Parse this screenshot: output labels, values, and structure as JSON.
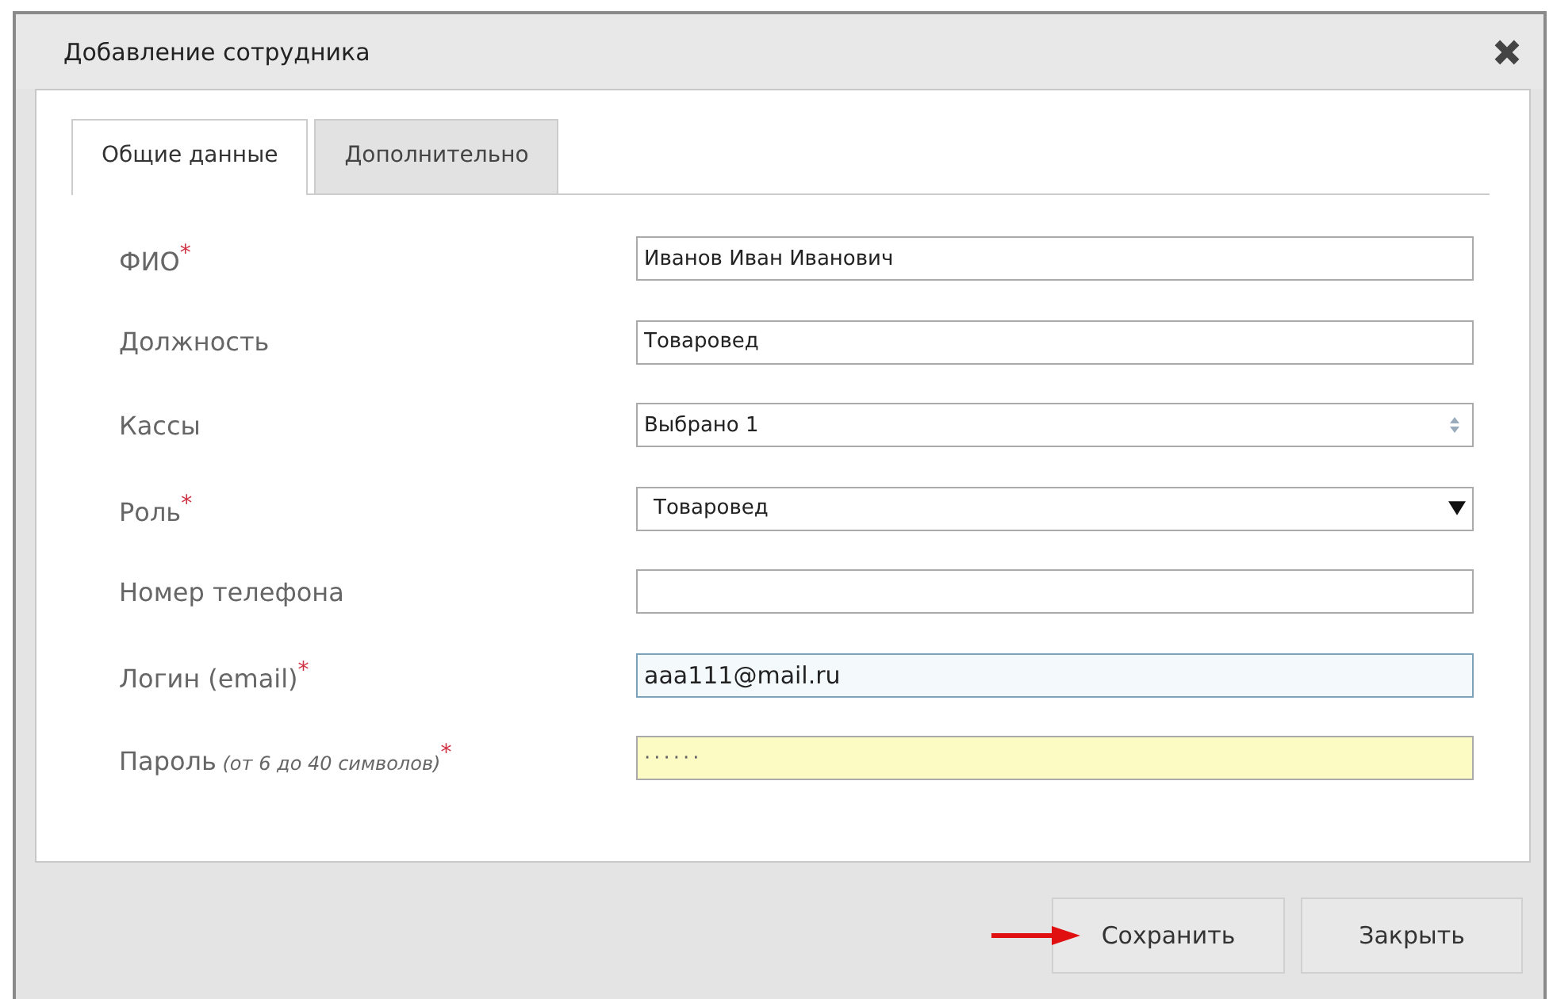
{
  "window": {
    "title": "Добавление сотрудника"
  },
  "tabs": [
    {
      "label": "Общие данные",
      "selected": true
    },
    {
      "label": "Дополнительно",
      "selected": false
    }
  ],
  "fields": [
    {
      "kind": "text",
      "label": "ФИО",
      "required_mark": "*",
      "value": "Иванов Иван Иванович",
      "focused": false
    },
    {
      "kind": "text",
      "label": "Должность",
      "value": "Товаровед",
      "focused": false
    },
    {
      "kind": "multiselect",
      "label": "Кассы",
      "value": "Выбрано 1",
      "focused": false
    },
    {
      "kind": "select",
      "label": "Роль",
      "required_mark": "*",
      "value": "Товаровед",
      "focused": false
    },
    {
      "kind": "text",
      "label": "Номер телефона",
      "focused": false
    },
    {
      "kind": "text",
      "label": "Логин (email)",
      "required_mark": "*",
      "value": "aaa111@mail.ru",
      "focused": true
    },
    {
      "kind": "password",
      "label": "Пароль",
      "hint": "(от 6 до 40 символов)",
      "required_mark": "*",
      "value": "······",
      "focused": false
    }
  ],
  "buttons": [
    {
      "label": "Сохранить",
      "pointed": true
    },
    {
      "label": "Закрыть",
      "pointed": false
    }
  ]
}
